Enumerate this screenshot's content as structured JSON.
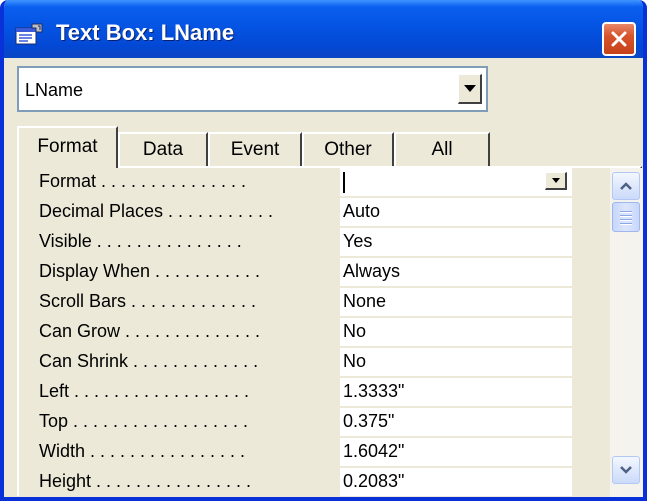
{
  "window": {
    "title": "Text Box: LName"
  },
  "object_selector": {
    "value": "LName"
  },
  "tabs": [
    {
      "label": "Format",
      "active": true
    },
    {
      "label": "Data",
      "active": false
    },
    {
      "label": "Event",
      "active": false
    },
    {
      "label": "Other",
      "active": false
    },
    {
      "label": "All",
      "active": false
    }
  ],
  "properties": [
    {
      "label": "Format . . . . . . . . . . . . . . .",
      "value": ""
    },
    {
      "label": "Decimal Places . . . . . . . . . . .",
      "value": "Auto"
    },
    {
      "label": "Visible . . . . . . . . . . . . . . .",
      "value": "Yes"
    },
    {
      "label": "Display When . . . . . . . . . . .",
      "value": "Always"
    },
    {
      "label": "Scroll Bars . . . . . . . . . . . . .",
      "value": "None"
    },
    {
      "label": "Can Grow . . . . . . . . . . . . . .",
      "value": "No"
    },
    {
      "label": "Can Shrink . . . . . . . . . . . . .",
      "value": "No"
    },
    {
      "label": "Left . . . . . . . . . . . . . . . . . .",
      "value": "1.3333\""
    },
    {
      "label": "Top . . . . . . . . . . . . . . . . . .",
      "value": "0.375\""
    },
    {
      "label": "Width . . . . . . . . . . . . . . . .",
      "value": "1.6042\""
    },
    {
      "label": "Height . . . . . . . . . . . . . . . .",
      "value": "0.2083\""
    }
  ],
  "icons": {
    "title": "properties-icon",
    "close": "close-icon",
    "dropdown": "chevron-down-icon",
    "scroll_up": "scroll-up-icon",
    "scroll_down": "scroll-down-icon"
  },
  "colors": {
    "titlebar": "#0554e3",
    "face": "#ece9d8",
    "close": "#d7542b"
  }
}
